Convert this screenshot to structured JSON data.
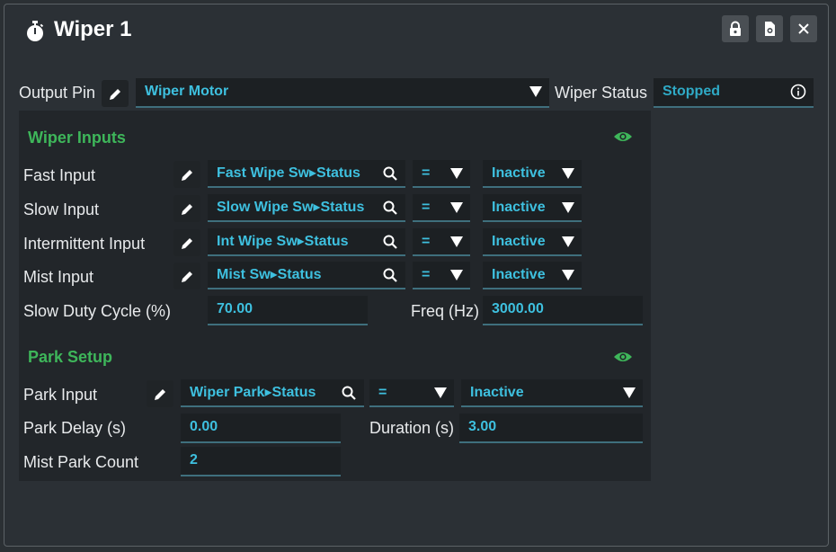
{
  "window": {
    "title": "Wiper 1"
  },
  "output": {
    "pin_label": "Output Pin",
    "pin_value": "Wiper Motor",
    "status_label": "Wiper Status",
    "status_value": "Stopped"
  },
  "wiper_inputs": {
    "title": "Wiper Inputs",
    "rows": [
      {
        "label": "Fast Input",
        "source": "Fast Wipe Sw▸Status",
        "operator": "=",
        "state": "Inactive"
      },
      {
        "label": "Slow Input",
        "source": "Slow Wipe Sw▸Status",
        "operator": "=",
        "state": "Inactive"
      },
      {
        "label": "Intermittent Input",
        "source": "Int Wipe Sw▸Status",
        "operator": "=",
        "state": "Inactive"
      },
      {
        "label": "Mist Input",
        "source": "Mist Sw▸Status",
        "operator": "=",
        "state": "Inactive"
      }
    ],
    "duty_label": "Slow Duty Cycle (%)",
    "duty_value": "70.00",
    "freq_label": "Freq (Hz)",
    "freq_value": "3000.00"
  },
  "park_setup": {
    "title": "Park Setup",
    "input_label": "Park Input",
    "input_source": "Wiper Park▸Status",
    "input_operator": "=",
    "input_state": "Inactive",
    "delay_label": "Park Delay (s)",
    "delay_value": "0.00",
    "duration_label": "Duration (s)",
    "duration_value": "3.00",
    "mist_count_label": "Mist Park Count",
    "mist_count_value": "2"
  },
  "colors": {
    "accent_text": "#3ec0df",
    "section_green": "#3eb65a",
    "field_bg": "#1c2023",
    "panel_bg": "#22262a",
    "window_bg": "#2b3035"
  }
}
